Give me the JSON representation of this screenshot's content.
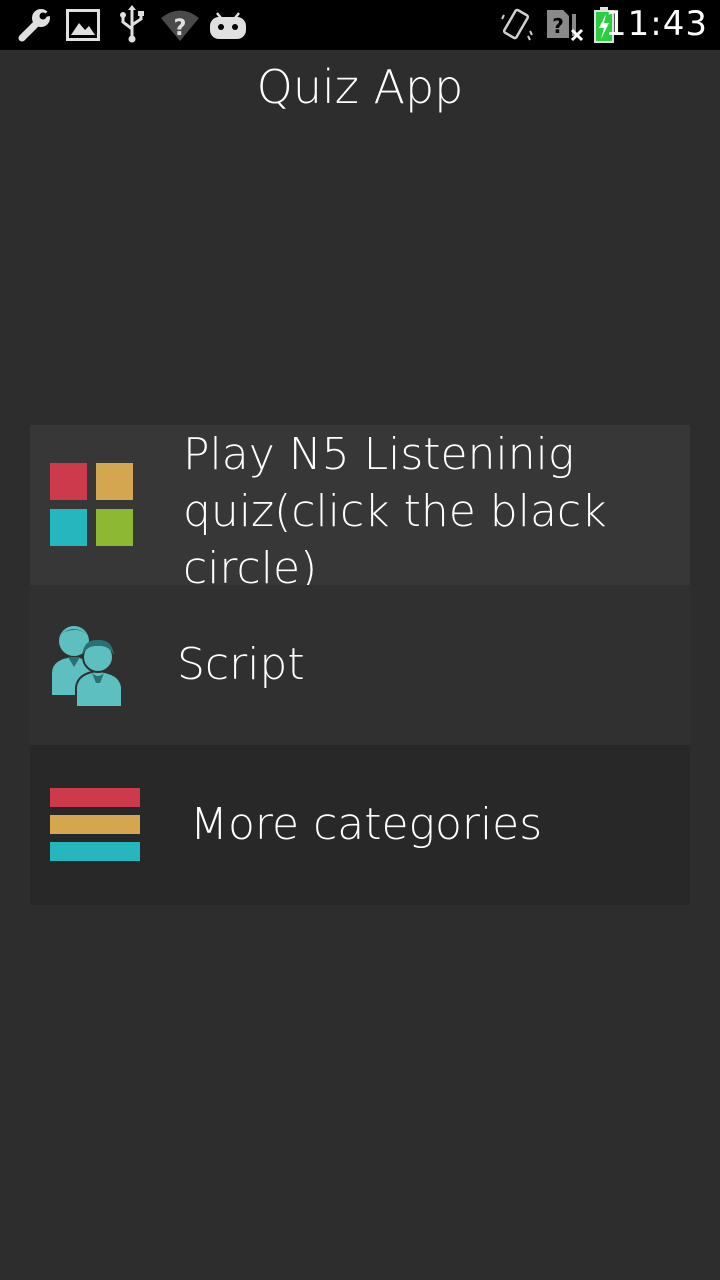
{
  "status_bar": {
    "time": "11:43",
    "left_icons": [
      "wrench-icon",
      "image-icon",
      "usb-icon",
      "wifi-unknown-icon",
      "android-icon"
    ],
    "right_icons": [
      "vibrate-icon",
      "no-sim-signal-icon",
      "battery-charging-icon"
    ],
    "battery_color": "#2ecc40"
  },
  "header": {
    "title": "Quiz App"
  },
  "menu": {
    "items": [
      {
        "label": "Play N5 Listeninig quiz(click the black circle)",
        "icon": "grid-tiles-icon"
      },
      {
        "label": "Script",
        "icon": "users-icon"
      },
      {
        "label": "More categories",
        "icon": "stacked-bars-icon"
      }
    ]
  },
  "colors": {
    "background": "#2d2d2d",
    "status_bar": "#000000",
    "red": "#cd3a4c",
    "gold": "#d4a64f",
    "teal": "#26b6be",
    "green": "#8db832",
    "people_teal": "#5dbfc0"
  }
}
